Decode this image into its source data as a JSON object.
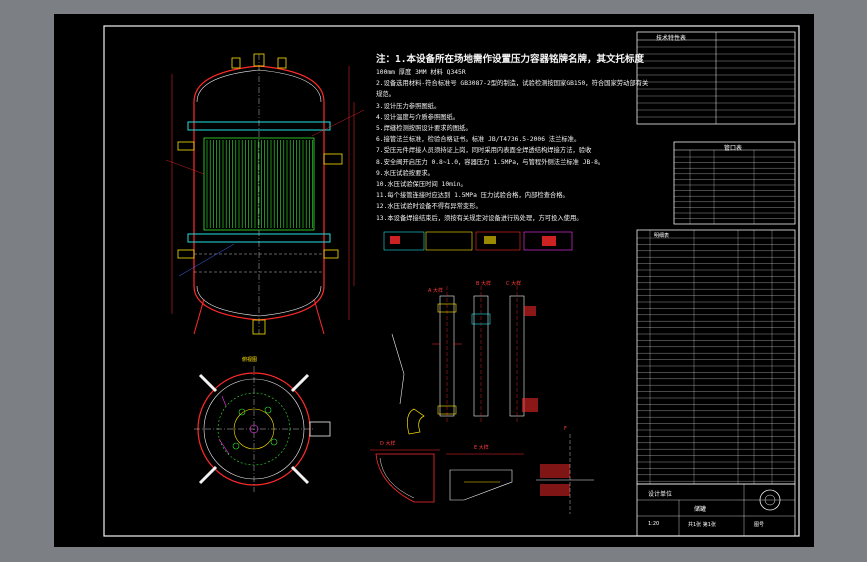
{
  "notes": {
    "title": "注：1.本设备所在场地需作设置压力容器铭牌名牌，其文托标度",
    "lines": [
      "100mm 厚度 3MM 材料 Q345R",
      "2.设备选用材料-符合标准号 GB3087-2型的制造，试验检测按国家GB150，符合国家劳动部有关",
      "规范。",
      "3.设计压力参照图纸。",
      "4.设计温度与介质参照图纸。",
      "5.焊缝检测按照设计要求的图纸。",
      "6.接管法兰标准，检验合格证书。标准 JB/T4736.5-2006 法兰标准。",
      "7.受压元件焊接人员须持证上岗，同时采用内表面全焊透结构焊接方法，验收",
      "8.安全阀开启压力 0.8~1.0，容器压力 1.5MPa，与管程外侧法兰标准 JB-8。",
      "9.水压试验按要求。",
      "10.水压试验保压时间 10min。",
      "11.每个接管连接时应达到 1.5MPa 压力试验合格，内部检查合格。",
      "12.水压试验时设备不得有异常变形。",
      "13.本设备焊接结束后，须按有关规定对设备进行热处理，方可投入使用。"
    ]
  },
  "view_labels": {
    "plan_view": "俯视图",
    "detail_a": "A 大样",
    "detail_b": "B 大样",
    "detail_c": "C 大样",
    "detail_d": "D 大样",
    "detail_e": "E 大样",
    "detail_f": "F"
  },
  "tables": {
    "tech_title": "技术特性表",
    "nozzle_title": "管口表",
    "parts_title": "明细表"
  },
  "title_block": {
    "project": "设计单位",
    "drawing_name": "储罐",
    "scale": "1:20",
    "sheet": "共1张 第1张",
    "drawing_no": "图号"
  },
  "colors": {
    "background": "#000000",
    "outer_bg": "#7c7f84",
    "line_red": "#ff2a2a",
    "line_green": "#35e835",
    "line_yellow": "#ffe300",
    "line_cyan": "#23e0e6",
    "line_blue": "#3b6bff",
    "line_white": "#f2f2f2",
    "line_magenta": "#ff37ff"
  }
}
